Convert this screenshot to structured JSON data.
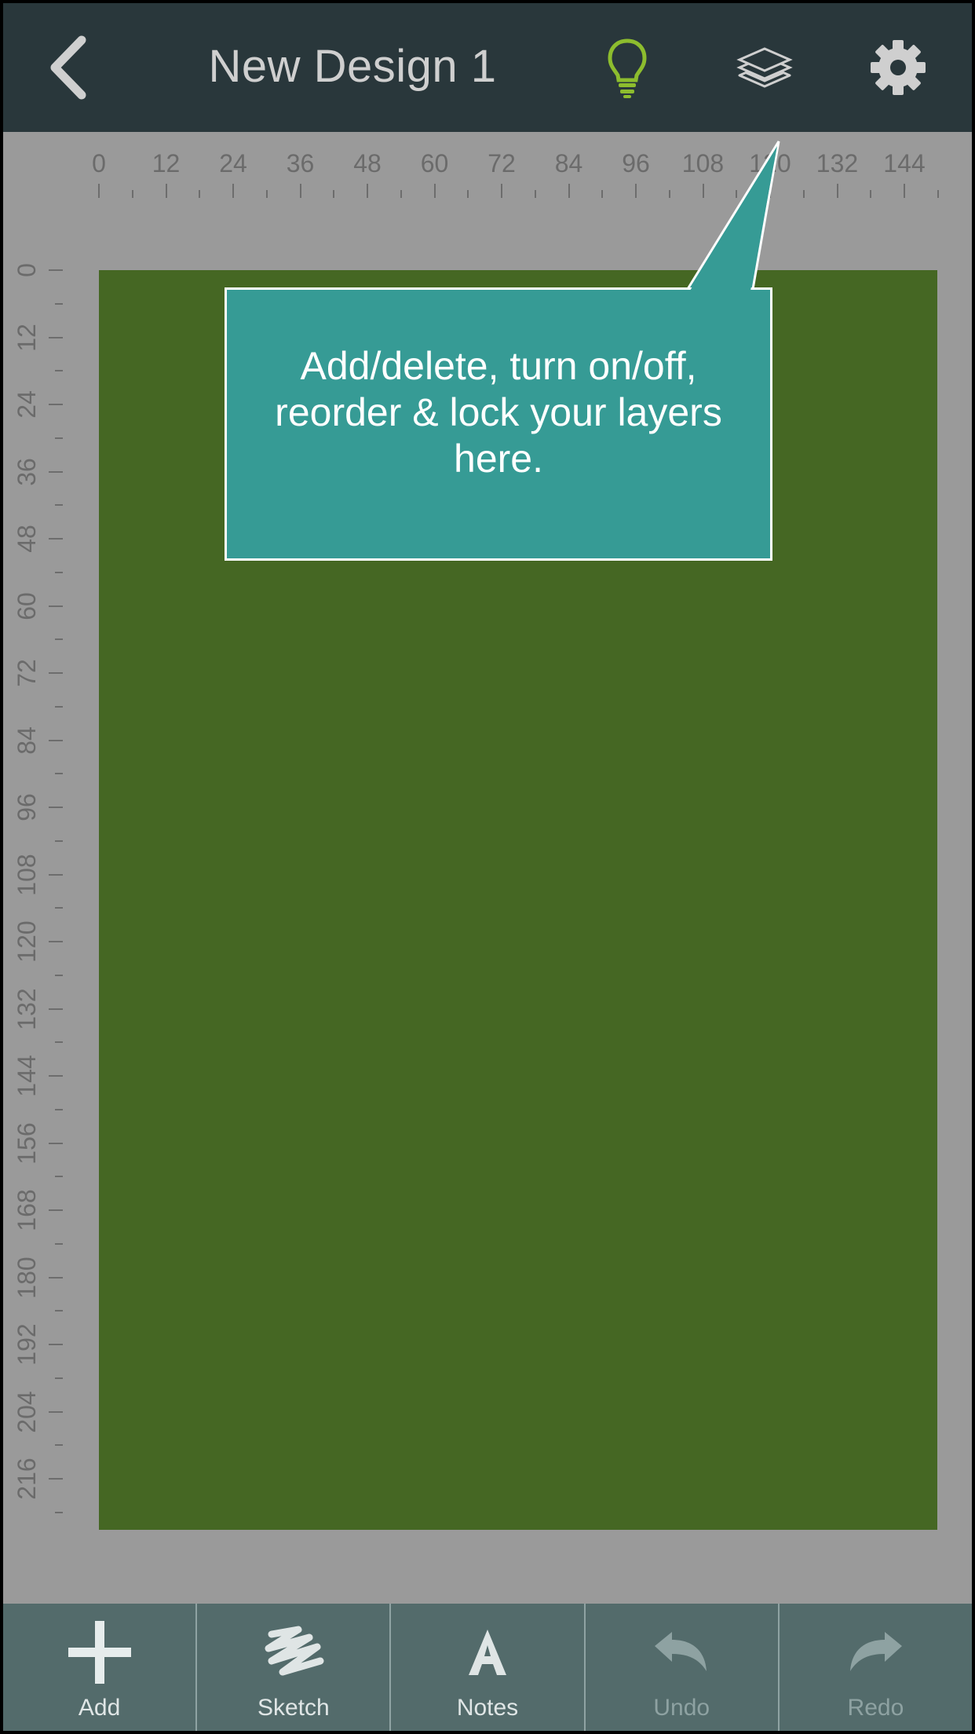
{
  "header": {
    "title": "New Design 1",
    "back_icon": "chevron-left-icon",
    "tips_icon": "lightbulb-icon",
    "layers_icon": "layers-icon",
    "settings_icon": "gear-icon",
    "tips_color": "#8dbd2e"
  },
  "rulers": {
    "top_labels": [
      "0",
      "12",
      "24",
      "36",
      "48",
      "60",
      "72",
      "84",
      "96",
      "108",
      "120",
      "132",
      "144"
    ],
    "left_labels": [
      "0",
      "12",
      "24",
      "36",
      "48",
      "60",
      "72",
      "84",
      "96",
      "108",
      "120",
      "132",
      "144",
      "156",
      "168",
      "180",
      "192",
      "204",
      "216"
    ]
  },
  "canvas": {
    "board_color": "#456723",
    "workspace_color": "#9a9a9a"
  },
  "tooltip": {
    "text": "Add/delete, turn on/off, reorder & lock your layers here.",
    "color": "#369b95"
  },
  "toolbar": {
    "add_label": "Add",
    "sketch_label": "Sketch",
    "notes_label": "Notes",
    "undo_label": "Undo",
    "redo_label": "Redo"
  }
}
